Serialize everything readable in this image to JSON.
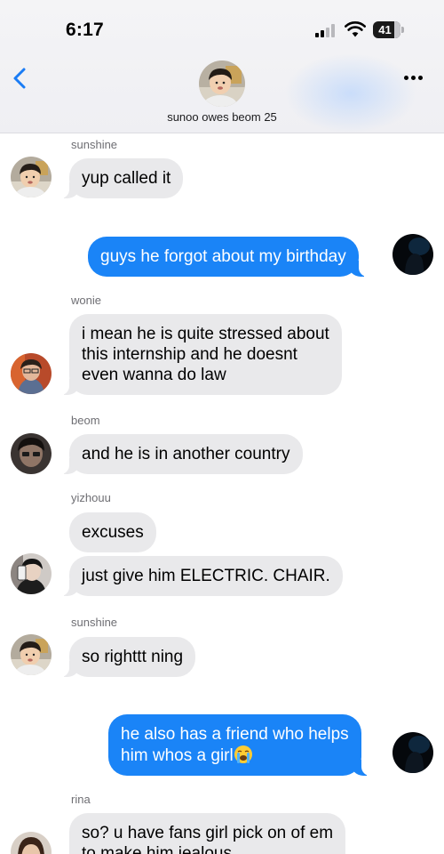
{
  "status_bar": {
    "time": "6:17",
    "battery": "41"
  },
  "header": {
    "group_name": "sunoo owes beom 25"
  },
  "messages": [
    {
      "sender": "sunshine",
      "text": "yup called it"
    },
    {
      "text": "guys he forgot about my birthday"
    },
    {
      "sender": "wonie",
      "lines": [
        "i mean he is quite stressed about",
        "this internship and he doesnt",
        "even wanna do law"
      ]
    },
    {
      "sender": "beom",
      "text": "and he is in another country"
    },
    {
      "sender": "yizhouu",
      "text": "excuses"
    },
    {
      "text": "just give him ELECTRIC. CHAIR."
    },
    {
      "sender": "sunshine",
      "text": "so righttt ning"
    },
    {
      "lines": [
        "he also has a friend who helps",
        "him whos a girl"
      ]
    },
    {
      "sender": "rina",
      "lines": [
        "so? u have fans girl pick on of em",
        "to make him jealous"
      ]
    }
  ],
  "colors": {
    "outgoing_bubble": "#1a84f7",
    "incoming_bubble": "#e9e9eb",
    "accent": "#1a7cf5"
  },
  "icons": [
    "back-chevron-icon",
    "more-options-icon",
    "cellular-signal-icon",
    "wifi-icon",
    "battery-icon",
    "loudly-crying-face-emoji"
  ]
}
